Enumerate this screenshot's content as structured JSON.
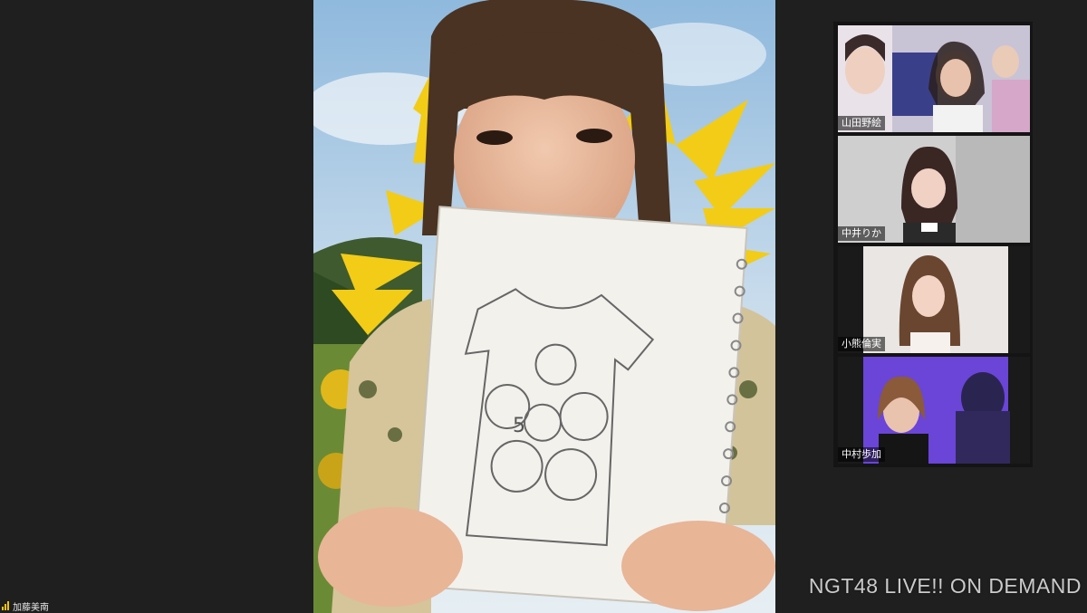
{
  "active_speaker": {
    "name": "加藤美南",
    "icon": "signal-bars-icon"
  },
  "watermark": "NGT48 LIVE!! ON DEMAND",
  "participants": [
    {
      "name": "山田野絵"
    },
    {
      "name": "中井りか"
    },
    {
      "name": "小熊倫実"
    },
    {
      "name": "中村歩加"
    }
  ],
  "sketch": {
    "number": "5"
  },
  "colors": {
    "background": "#1f1f1f",
    "accent_signal": "#f1c40f",
    "active_tile_border": "#7a5cff"
  }
}
